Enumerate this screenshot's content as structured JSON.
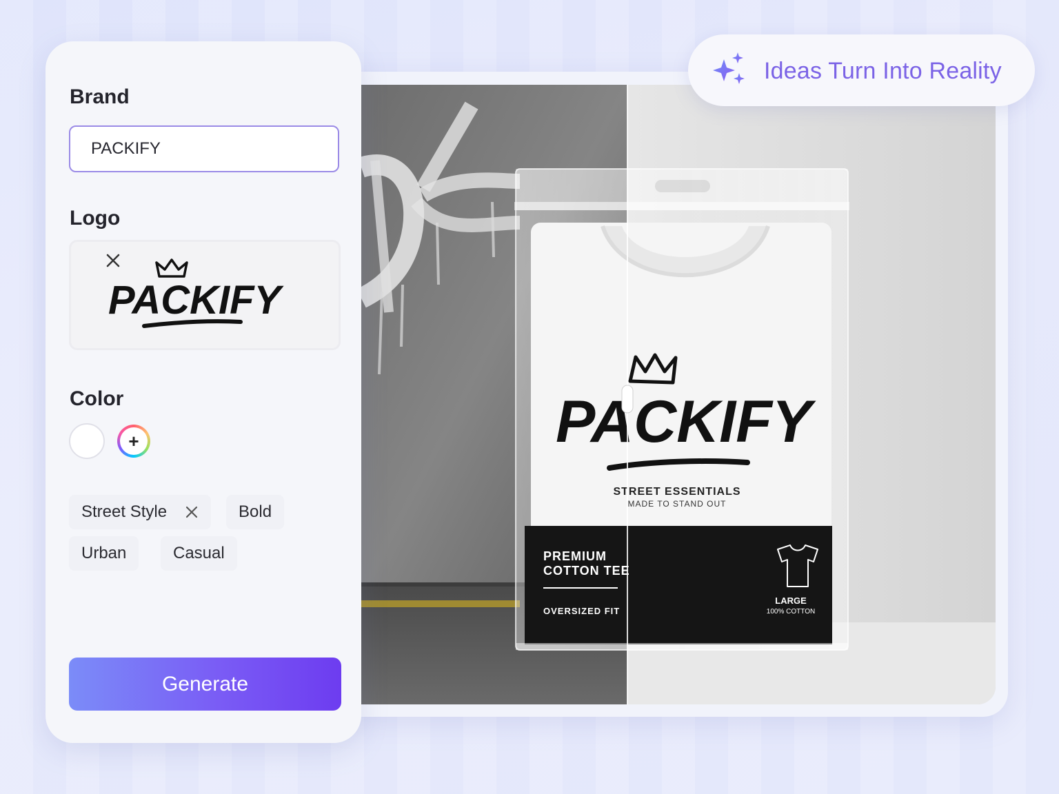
{
  "badge": {
    "text": "Ideas Turn Into Reality"
  },
  "form": {
    "brand_label": "Brand",
    "brand_value": "PACKIFY",
    "logo_label": "Logo",
    "logo_text": "PACKIFY",
    "color_label": "Color",
    "add_color_symbol": "+",
    "tags": [
      {
        "label": "Street Style",
        "removable": true
      },
      {
        "label": "Bold"
      },
      {
        "label": "Urban"
      },
      {
        "label": "Casual"
      }
    ],
    "generate_label": "Generate"
  },
  "product": {
    "brand": "PACKIFY",
    "tagline": "STREET ESSENTIALS",
    "subtagline": "MADE TO STAND OUT",
    "label_line1": "PREMIUM",
    "label_line2": "COTTON TEE",
    "fit": "OVERSIZED FIT",
    "size": "LARGE",
    "material": "100% COTTON"
  },
  "colors": {
    "accent": "#7b63e6",
    "button_start": "#7b8cf8",
    "button_end": "#6d3cf0",
    "swatch": "#ffffff"
  },
  "icons": [
    "sparkle-icon",
    "close-icon",
    "plus-icon",
    "tshirt-icon",
    "crown-icon"
  ]
}
